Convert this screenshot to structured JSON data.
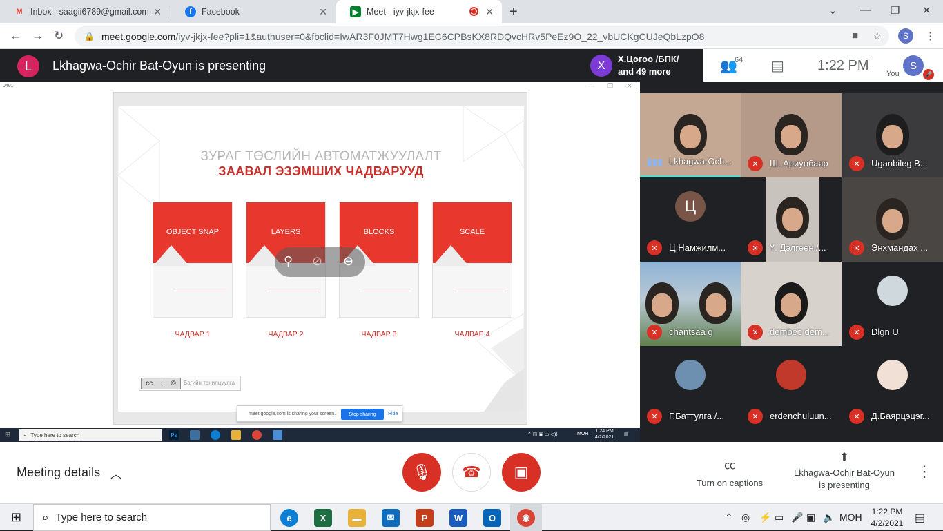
{
  "browser": {
    "tabs": [
      {
        "label": "Inbox - saagii6789@gmail.com -",
        "favicon": "gmail-icon",
        "favicon_color": "#ea4335"
      },
      {
        "label": "Facebook",
        "favicon": "facebook-icon",
        "favicon_color": "#1877f2"
      },
      {
        "label": "Meet - iyv-jkjx-fee",
        "favicon": "meet-icon",
        "favicon_color": "#00832d"
      }
    ],
    "url_host": "meet.google.com",
    "url_path": "/iyv-jkjx-fee?pli=1&authuser=0&fbclid=IwAR3F0JMT7Hwg1EC6CPBsKX8RDQvcHRv5PeEz9O_22_vbUCKgCUJeQbLzpO8",
    "profile_initial": "S"
  },
  "meet": {
    "presenter_initial": "L",
    "presenter_title": "Lkhagwa-Ochir Bat-Oyun is presenting",
    "pinned_initial": "X",
    "pinned_name": "Х.Цогоо /БПК/",
    "pinned_more": "and 49 more",
    "people_count": "64",
    "time": "1:22 PM",
    "you_label": "You",
    "you_initial": "S"
  },
  "screen": {
    "window_label": "0401",
    "slide_title_1": "ЗУРАГ ТӨСЛИЙН АВТОМАТЖУУЛАЛТ",
    "slide_title_2": "ЗААВАЛ ЭЗЭМШИХ ЧАДВАРУУД",
    "cards": [
      {
        "label": "OBJECT SNAP",
        "caption": "ЧАДВАР 1"
      },
      {
        "label": "LAYERS",
        "caption": "ЧАДВАР 2"
      },
      {
        "label": "BLOCKS",
        "caption": "ЧАДВАР 3"
      },
      {
        "label": "SCALE",
        "caption": "ЧАДВАР 4"
      }
    ],
    "cc_text": "Багийн танилцуулга",
    "cc_badge": [
      "cc",
      "i",
      "©"
    ],
    "share_notice": "meet.google.com is sharing your screen.",
    "stop_sharing": "Stop sharing",
    "hide": "Hide",
    "inner_search": "Type here to search",
    "inner_time": "1:24 PM",
    "inner_date": "4/2/2021",
    "inner_lang": "МОН",
    "inner_apps": [
      "Ps",
      "",
      "",
      "",
      "",
      ""
    ]
  },
  "participants": [
    {
      "name": "Lkhagwa-Och...",
      "state": "speaking"
    },
    {
      "name": "Ш. Ариунбаяр",
      "state": "muted"
    },
    {
      "name": "Uganbileg B...",
      "state": "muted"
    },
    {
      "name": "Ц.Намжилм...",
      "state": "muted",
      "initial": "Ц",
      "color": "#795548"
    },
    {
      "name": "Ү. Дэлгөөн /...",
      "state": "muted"
    },
    {
      "name": "Энхмандах ...",
      "state": "muted"
    },
    {
      "name": "chantsaa g",
      "state": "muted"
    },
    {
      "name": "dembee dem...",
      "state": "muted"
    },
    {
      "name": "Dlgn U",
      "state": "muted"
    },
    {
      "name": "Г.Баттулга /...",
      "state": "muted"
    },
    {
      "name": "erdenchuluun...",
      "state": "muted"
    },
    {
      "name": "Д.Баярцэцэг...",
      "state": "muted"
    }
  ],
  "controls": {
    "meeting_details": "Meeting details",
    "captions": "Turn on captions",
    "presenting_1": "Lkhagwa-Ochir Bat-Oyun",
    "presenting_2": "is presenting"
  },
  "taskbar": {
    "search": "Type here to search",
    "time": "1:22 PM",
    "date": "4/2/2021",
    "lang": "МОН",
    "apps": [
      {
        "name": "edge-icon",
        "glyph": "e",
        "color": "#0c7fd4"
      },
      {
        "name": "excel-icon",
        "glyph": "X",
        "color": "#1d6f42"
      },
      {
        "name": "file-explorer-icon",
        "glyph": "▬",
        "color": "#e8b23a"
      },
      {
        "name": "mail-icon",
        "glyph": "✉",
        "color": "#0f6cbd"
      },
      {
        "name": "powerpoint-icon",
        "glyph": "P",
        "color": "#c43e1c"
      },
      {
        "name": "word-icon",
        "glyph": "W",
        "color": "#185abd"
      },
      {
        "name": "outlook-icon",
        "glyph": "O",
        "color": "#0364b8"
      },
      {
        "name": "chrome-icon",
        "glyph": "◉",
        "color": "#db4437"
      }
    ]
  }
}
